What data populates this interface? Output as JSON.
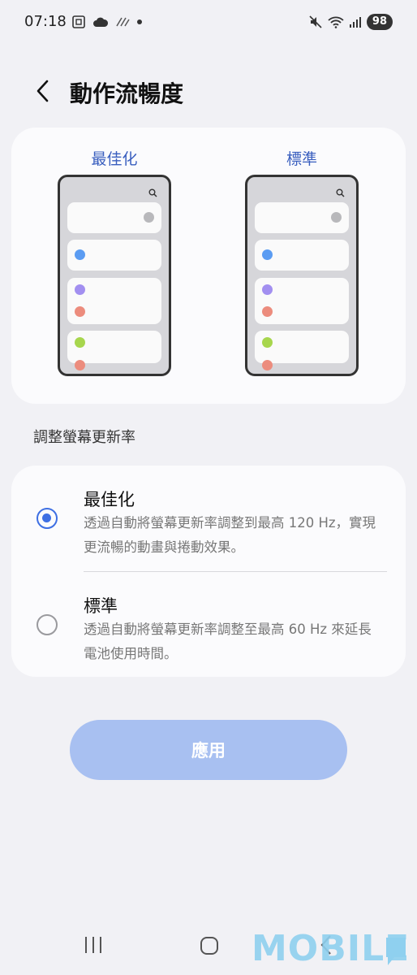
{
  "status_bar": {
    "time": "07:18",
    "battery": "98"
  },
  "header": {
    "title": "動作流暢度"
  },
  "preview": {
    "left_label": "最佳化",
    "right_label": "標準"
  },
  "section_label": "調整螢幕更新率",
  "options": [
    {
      "title": "最佳化",
      "description": "透過自動將螢幕更新率調整到最高 120 Hz，實現更流暢的動畫與捲動效果。",
      "selected": true
    },
    {
      "title": "標準",
      "description": "透過自動將螢幕更新率調整至最高 60 Hz 來延長電池使用時間。",
      "selected": false
    }
  ],
  "apply_button": "應用",
  "watermark": "MOBILE",
  "colors": {
    "accent": "#3e6fe3",
    "preview_label": "#3a5fbf",
    "apply_disabled": "#a8c0f1",
    "dot_blue": "#5b9cf2",
    "dot_purple": "#a28ff0",
    "dot_red": "#ec8c7d",
    "dot_green": "#a7d64d"
  }
}
